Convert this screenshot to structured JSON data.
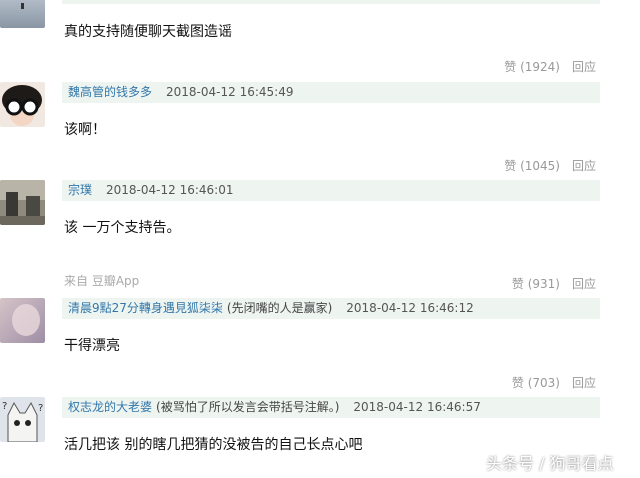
{
  "comments": [
    {
      "text": "真的支持随便聊天截图造谣",
      "votes": "赞 (1924)",
      "reply": "回应"
    },
    {
      "name": "魏高管的钱多多",
      "time": "2018-04-12 16:45:49",
      "text": "该啊！",
      "votes": "赞 (1045)",
      "reply": "回应"
    },
    {
      "name": "宗璞",
      "time": "2018-04-12 16:46:01",
      "text": "该 一万个支持告。",
      "source": "来自 豆瓣App",
      "votes": "赞 (931)",
      "reply": "回应"
    },
    {
      "name": "清晨9點27分轉身遇見狐柒柒",
      "note": "(先闭嘴的人是赢家)",
      "time": "2018-04-12 16:46:12",
      "text": "干得漂亮",
      "votes": "赞 (703)",
      "reply": "回应"
    },
    {
      "name": "权志龙的大老婆",
      "note": "(被骂怕了所以发言会带括号注解。)",
      "time": "2018-04-12 16:46:57",
      "text": "活几把该 别的瞎几把猜的没被告的自己长点心吧"
    }
  ],
  "watermark": "头条号 / 狗哥看点",
  "colors": {
    "username": "#3377aa",
    "meta_bg": "#eef5f1",
    "muted": "#999999"
  }
}
